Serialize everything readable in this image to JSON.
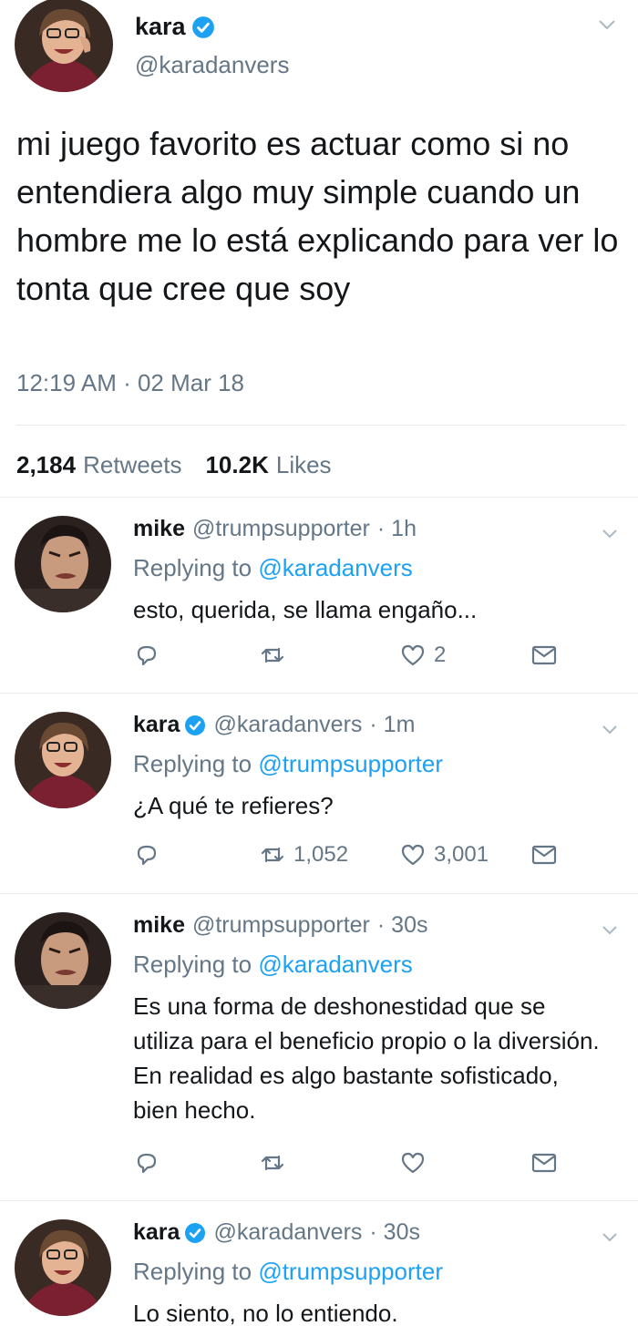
{
  "main_tweet": {
    "name": "kara",
    "handle": "@karadanvers",
    "text": "mi juego favorito es actuar como si no entendiera algo muy simple cuando un hombre me lo está explicando para ver lo tonta que cree que soy",
    "timestamp": "12:19 AM · 02 Mar 18",
    "retweets_count": "2,184",
    "retweets_label": "Retweets",
    "likes_count": "10.2K",
    "likes_label": "Likes"
  },
  "replies": [
    {
      "name": "mike",
      "handle": "@trumpsupporter",
      "time": "· 1h",
      "replying_prefix": "Replying to",
      "replying_to": "@karadanvers",
      "text": "esto, querida, se llama engaño...",
      "retweets": "",
      "likes": "2"
    },
    {
      "name": "kara",
      "handle": "@karadanvers",
      "time": "· 1m",
      "replying_prefix": "Replying to",
      "replying_to": "@trumpsupporter",
      "text": "¿A qué te refieres?",
      "retweets": "1,052",
      "likes": "3,001"
    },
    {
      "name": "mike",
      "handle": "@trumpsupporter",
      "time": "· 30s",
      "replying_prefix": "Replying to",
      "replying_to": "@karadanvers",
      "text": "Es una forma de deshonestidad que se utiliza para el beneficio propio o la diversión. En realidad es algo bastante sofisticado, bien hecho.",
      "retweets": "",
      "likes": ""
    },
    {
      "name": "kara",
      "handle": "@karadanvers",
      "time": "· 30s",
      "replying_prefix": "Replying to",
      "replying_to": "@trumpsupporter",
      "text": "Lo siento, no lo entiendo.",
      "retweets": "",
      "likes": ""
    }
  ],
  "icons": {
    "verified": "verified-badge-icon",
    "menu": "chevron-down-icon",
    "reply": "reply-icon",
    "retweet": "retweet-icon",
    "like": "heart-icon",
    "dm": "envelope-icon"
  },
  "colors": {
    "accent": "#1da1f2",
    "secondary_text": "#657786",
    "primary_text": "#14171a",
    "divider": "#e6ecf0"
  }
}
